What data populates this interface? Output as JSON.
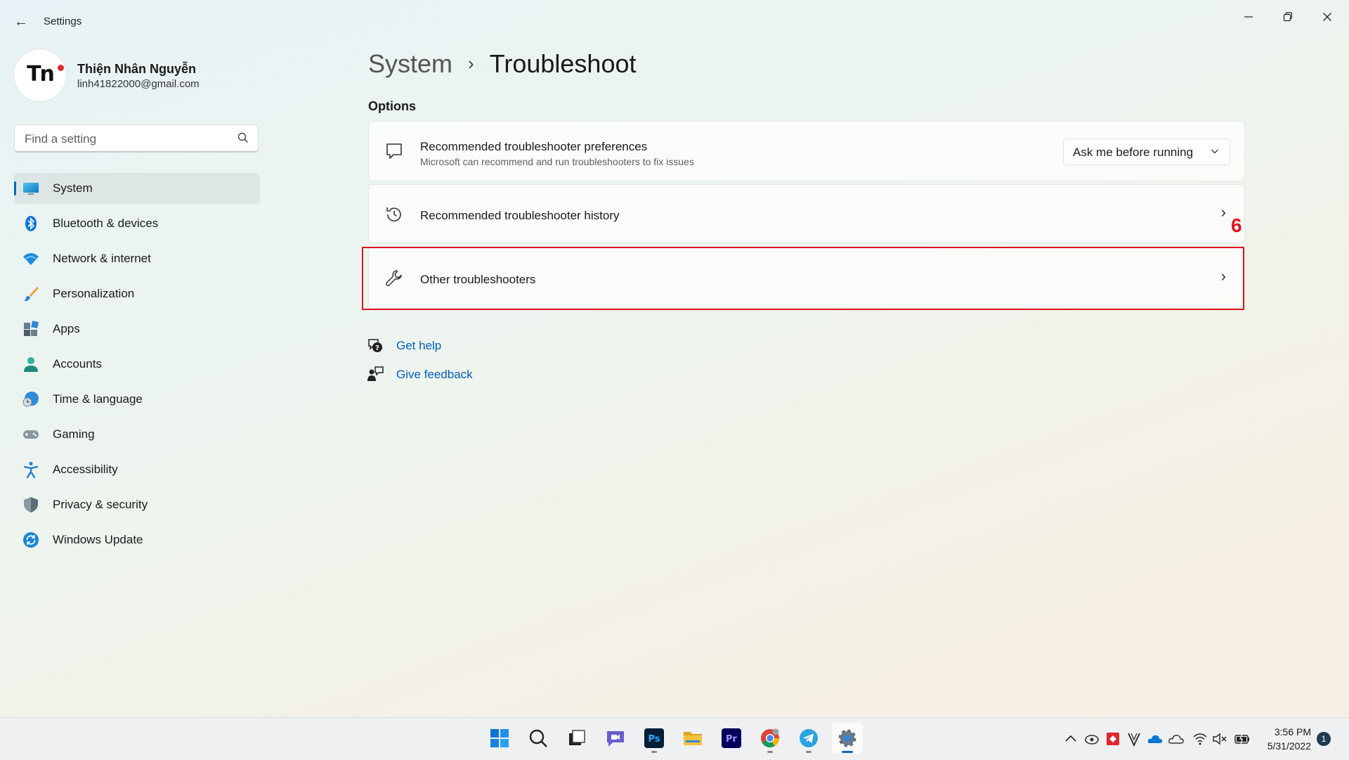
{
  "window": {
    "title": "Settings"
  },
  "profile": {
    "initials": "Tn",
    "name": "Thiện Nhân Nguyễn",
    "email": "linh41822000@gmail.com"
  },
  "search": {
    "placeholder": "Find a setting",
    "value": ""
  },
  "sidebar": {
    "items": [
      {
        "label": "System",
        "icon": "system-icon",
        "active": true
      },
      {
        "label": "Bluetooth & devices",
        "icon": "bluetooth-icon"
      },
      {
        "label": "Network & internet",
        "icon": "wifi-icon"
      },
      {
        "label": "Personalization",
        "icon": "brush-icon"
      },
      {
        "label": "Apps",
        "icon": "apps-icon"
      },
      {
        "label": "Accounts",
        "icon": "person-icon"
      },
      {
        "label": "Time & language",
        "icon": "globe-clock-icon"
      },
      {
        "label": "Gaming",
        "icon": "gamepad-icon"
      },
      {
        "label": "Accessibility",
        "icon": "accessibility-icon"
      },
      {
        "label": "Privacy & security",
        "icon": "shield-icon"
      },
      {
        "label": "Windows Update",
        "icon": "update-icon"
      }
    ]
  },
  "main": {
    "breadcrumb_parent": "System",
    "breadcrumb_separator": "›",
    "breadcrumb_current": "Troubleshoot",
    "section_label": "Options",
    "cards": [
      {
        "title": "Recommended troubleshooter preferences",
        "subtitle": "Microsoft can recommend and run troubleshooters to fix issues",
        "icon": "chat-bubble-icon",
        "dropdown_value": "Ask me before running"
      },
      {
        "title": "Recommended troubleshooter history",
        "icon": "history-icon",
        "chevron": "›"
      },
      {
        "title": "Other troubleshooters",
        "icon": "wrench-icon",
        "chevron": "›"
      }
    ],
    "links": [
      {
        "label": "Get help",
        "icon": "help-icon"
      },
      {
        "label": "Give feedback",
        "icon": "feedback-icon"
      }
    ]
  },
  "annotation": {
    "step_number": "6",
    "color": "#e0131f"
  },
  "taskbar": {
    "apps": [
      {
        "name": "start-icon"
      },
      {
        "name": "search-icon"
      },
      {
        "name": "task-view-icon"
      },
      {
        "name": "chat-icon"
      },
      {
        "name": "photoshop-icon",
        "label": "Ps",
        "running": true
      },
      {
        "name": "file-explorer-icon"
      },
      {
        "name": "premiere-icon",
        "label": "Pr"
      },
      {
        "name": "chrome-icon",
        "running": true
      },
      {
        "name": "telegram-icon",
        "running": true
      },
      {
        "name": "settings-icon",
        "active": true
      }
    ],
    "tray_icons": [
      "chevron-up-icon",
      "cloud-sync-icon",
      "red-app-icon",
      "v-icon",
      "onedrive-icon",
      "cloud-icon",
      "wifi-icon",
      "mute-icon",
      "battery-icon"
    ],
    "time": "3:56 PM",
    "date": "5/31/2022",
    "notification_count": "1"
  },
  "colors": {
    "accent": "#0067c0",
    "link": "#0060b8"
  }
}
